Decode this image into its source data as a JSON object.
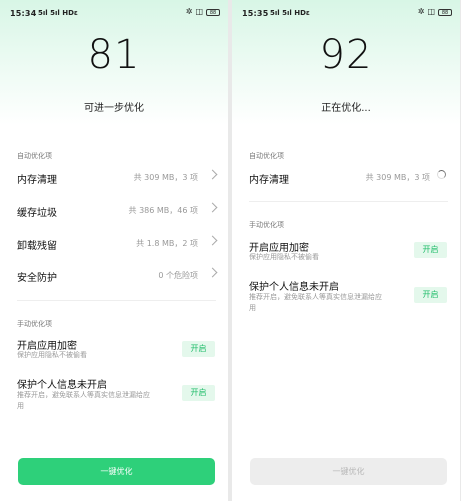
{
  "left": {
    "status_time": "15:34",
    "status_signal": "5ıl 5ıl HDε",
    "score": "81",
    "status_text": "可进一步优化",
    "auto_label": "自动优化项",
    "auto_items": [
      {
        "title": "内存清理",
        "value": "共 309 MB，3 项"
      },
      {
        "title": "缓存垃圾",
        "value": "共 386 MB，46 项"
      },
      {
        "title": "卸载残留",
        "value": "共 1.8 MB，2 项"
      },
      {
        "title": "安全防护",
        "value": "0 个危险项"
      }
    ],
    "manual_label": "手动优化项",
    "manual_items": [
      {
        "title": "开启应用加密",
        "sub": "保护应用隐私不被偷看",
        "button": "开启"
      },
      {
        "title": "保护个人信息未开启",
        "sub": "推荐开启，避免联系人等真实信息泄漏给应用",
        "button": "开启"
      }
    ],
    "bottom_button": "一键优化"
  },
  "right": {
    "status_time": "15:35",
    "status_signal": "5ıl 5ıl HDε",
    "score": "92",
    "status_text": "正在优化...",
    "auto_label": "自动优化项",
    "auto_items": [
      {
        "title": "内存清理",
        "value": "共 309 MB，3 项"
      }
    ],
    "manual_label": "手动优化项",
    "manual_items": [
      {
        "title": "开启应用加密",
        "sub": "保护应用隐私不被偷看",
        "button": "开启"
      },
      {
        "title": "保护个人信息未开启",
        "sub": "推荐开启，避免联系人等真实信息泄漏给应用",
        "button": "开启"
      }
    ],
    "bottom_button": "一键优化"
  },
  "status_icons": [
    "vibrate-icon",
    "nfc-icon",
    "battery-icon"
  ],
  "battery_text": "88",
  "colors": {
    "accent": "#2ed07a",
    "accent_text": "#1ebc69",
    "hero_bg": "#d8f6e6"
  }
}
